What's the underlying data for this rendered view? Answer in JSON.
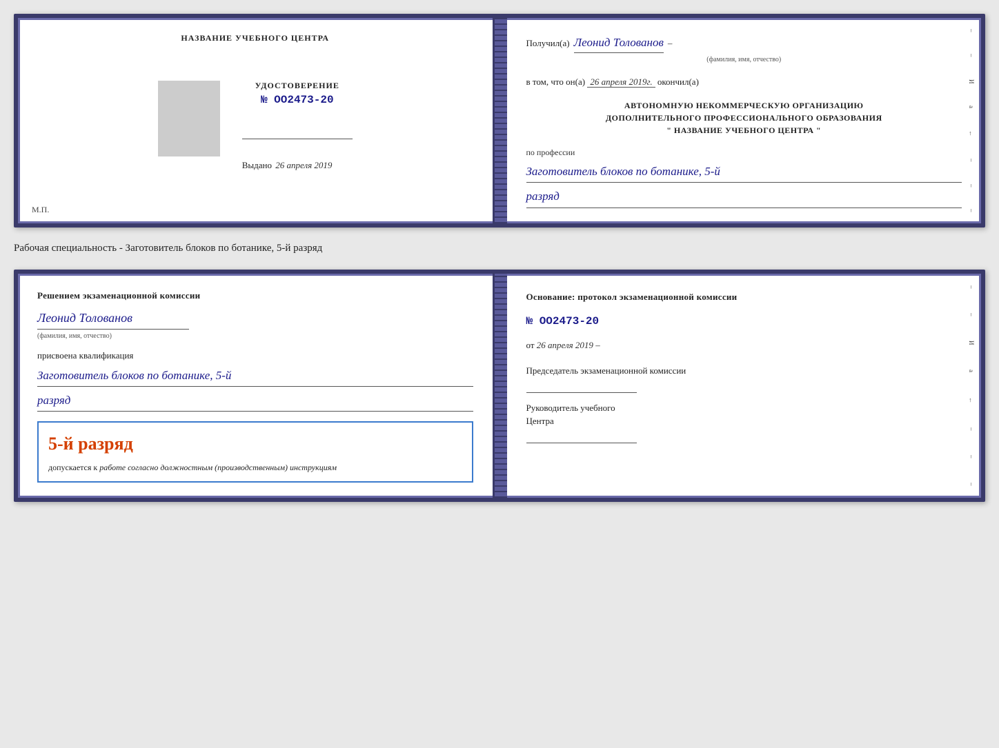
{
  "page": {
    "background": "#e8e8e8"
  },
  "specialty_label": "Рабочая специальность - Заготовитель блоков по ботанике, 5-й разряд",
  "top_card": {
    "left": {
      "header": "НАЗВАНИЕ УЧЕБНОГО ЦЕНТРА",
      "cert_label": "УДОСТОВЕРЕНИЕ",
      "cert_number": "№ OO2473-20",
      "issued_prefix": "Выдано",
      "issued_date": "26 апреля 2019",
      "mp_label": "М.П."
    },
    "right": {
      "recipient_prefix": "Получил(а)",
      "recipient_name": "Леонид Толованов",
      "recipient_hint": "(фамилия, имя, отчество)",
      "date_prefix": "в том, что он(а)",
      "date_value": "26 апреля 2019г.",
      "date_suffix": "окончил(а)",
      "org_line1": "АВТОНОМНУЮ НЕКОММЕРЧЕСКУЮ ОРГАНИЗАЦИЮ",
      "org_line2": "ДОПОЛНИТЕЛЬНОГО ПРОФЕССИОНАЛЬНОГО ОБРАЗОВАНИЯ",
      "org_line3": "\" НАЗВАНИЕ УЧЕБНОГО ЦЕНТРА \"",
      "profession_prefix": "по профессии",
      "profession_value": "Заготовитель блоков по ботанике, 5-й",
      "razryad_value": "разряд"
    }
  },
  "bottom_card": {
    "left": {
      "decision_text": "Решением экзаменационной комиссии",
      "name_value": "Леонид Толованов",
      "name_hint": "(фамилия, имя, отчество)",
      "qualification_prefix": "присвоена квалификация",
      "qualification_value": "Заготовитель блоков по ботанике, 5-й",
      "razryad_value": "разряд",
      "highlight_rank": "5-й разряд",
      "highlight_desc_prefix": "допускается к",
      "highlight_desc_em": "работе согласно должностным (производственным) инструкциям"
    },
    "right": {
      "osnov_label": "Основание: протокол экзаменационной комиссии",
      "proto_number": "№ OO2473-20",
      "from_prefix": "от",
      "from_date": "26 апреля 2019",
      "chairman_label": "Председатель экзаменационной комиссии",
      "director_label_line1": "Руководитель учебного",
      "director_label_line2": "Центра"
    }
  },
  "right_marks": [
    "–",
    "И",
    "а",
    "←",
    "–",
    "–",
    "–",
    "–"
  ]
}
